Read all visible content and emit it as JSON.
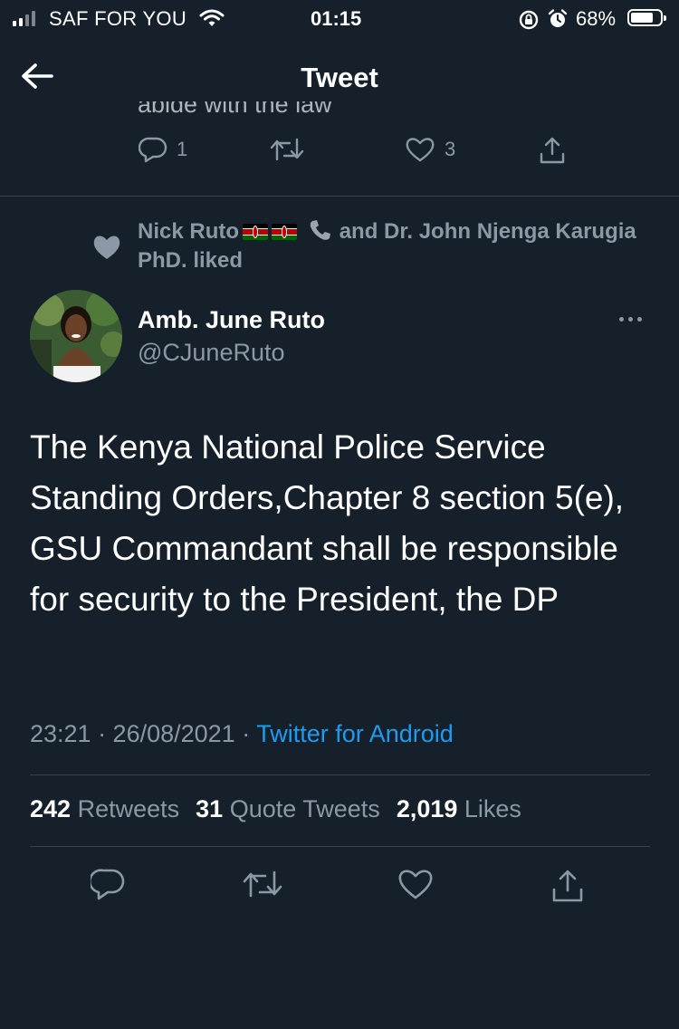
{
  "status_bar": {
    "carrier": "SAF FOR YOU",
    "time": "01:15",
    "battery_percent": "68%",
    "battery_level": 0.68,
    "icons": [
      "signal-icon",
      "wifi-icon",
      "rotation-lock-icon",
      "alarm-icon",
      "battery-icon"
    ]
  },
  "header": {
    "title": "Tweet",
    "back_icon": "back-arrow-icon"
  },
  "previous_tweet": {
    "text_fragment": "abide with the law",
    "reply_count": "1",
    "like_count": "3"
  },
  "tweet": {
    "social_context": {
      "name_1": "Nick Ruto",
      "connector": "and Dr. John Njenga Karugia PhD. liked"
    },
    "author": {
      "name": "Amb. June Ruto",
      "handle": "@CJuneRuto"
    },
    "text": "The Kenya National Police Service Standing Orders,Chapter 8 section 5(e), GSU Commandant shall be responsible for security to the President, the DP",
    "time": "23:21 · 26/08/2021 ·",
    "source": "Twitter for Android",
    "stats": {
      "retweets_count": "242",
      "retweets_label": "Retweets",
      "quotes_count": "31",
      "quotes_label": "Quote Tweets",
      "likes_count": "2,019",
      "likes_label": "Likes"
    }
  },
  "colors": {
    "background": "#15202b",
    "secondary_text": "#8b98a5",
    "link": "#1d9bf0",
    "divider": "#38444d"
  }
}
